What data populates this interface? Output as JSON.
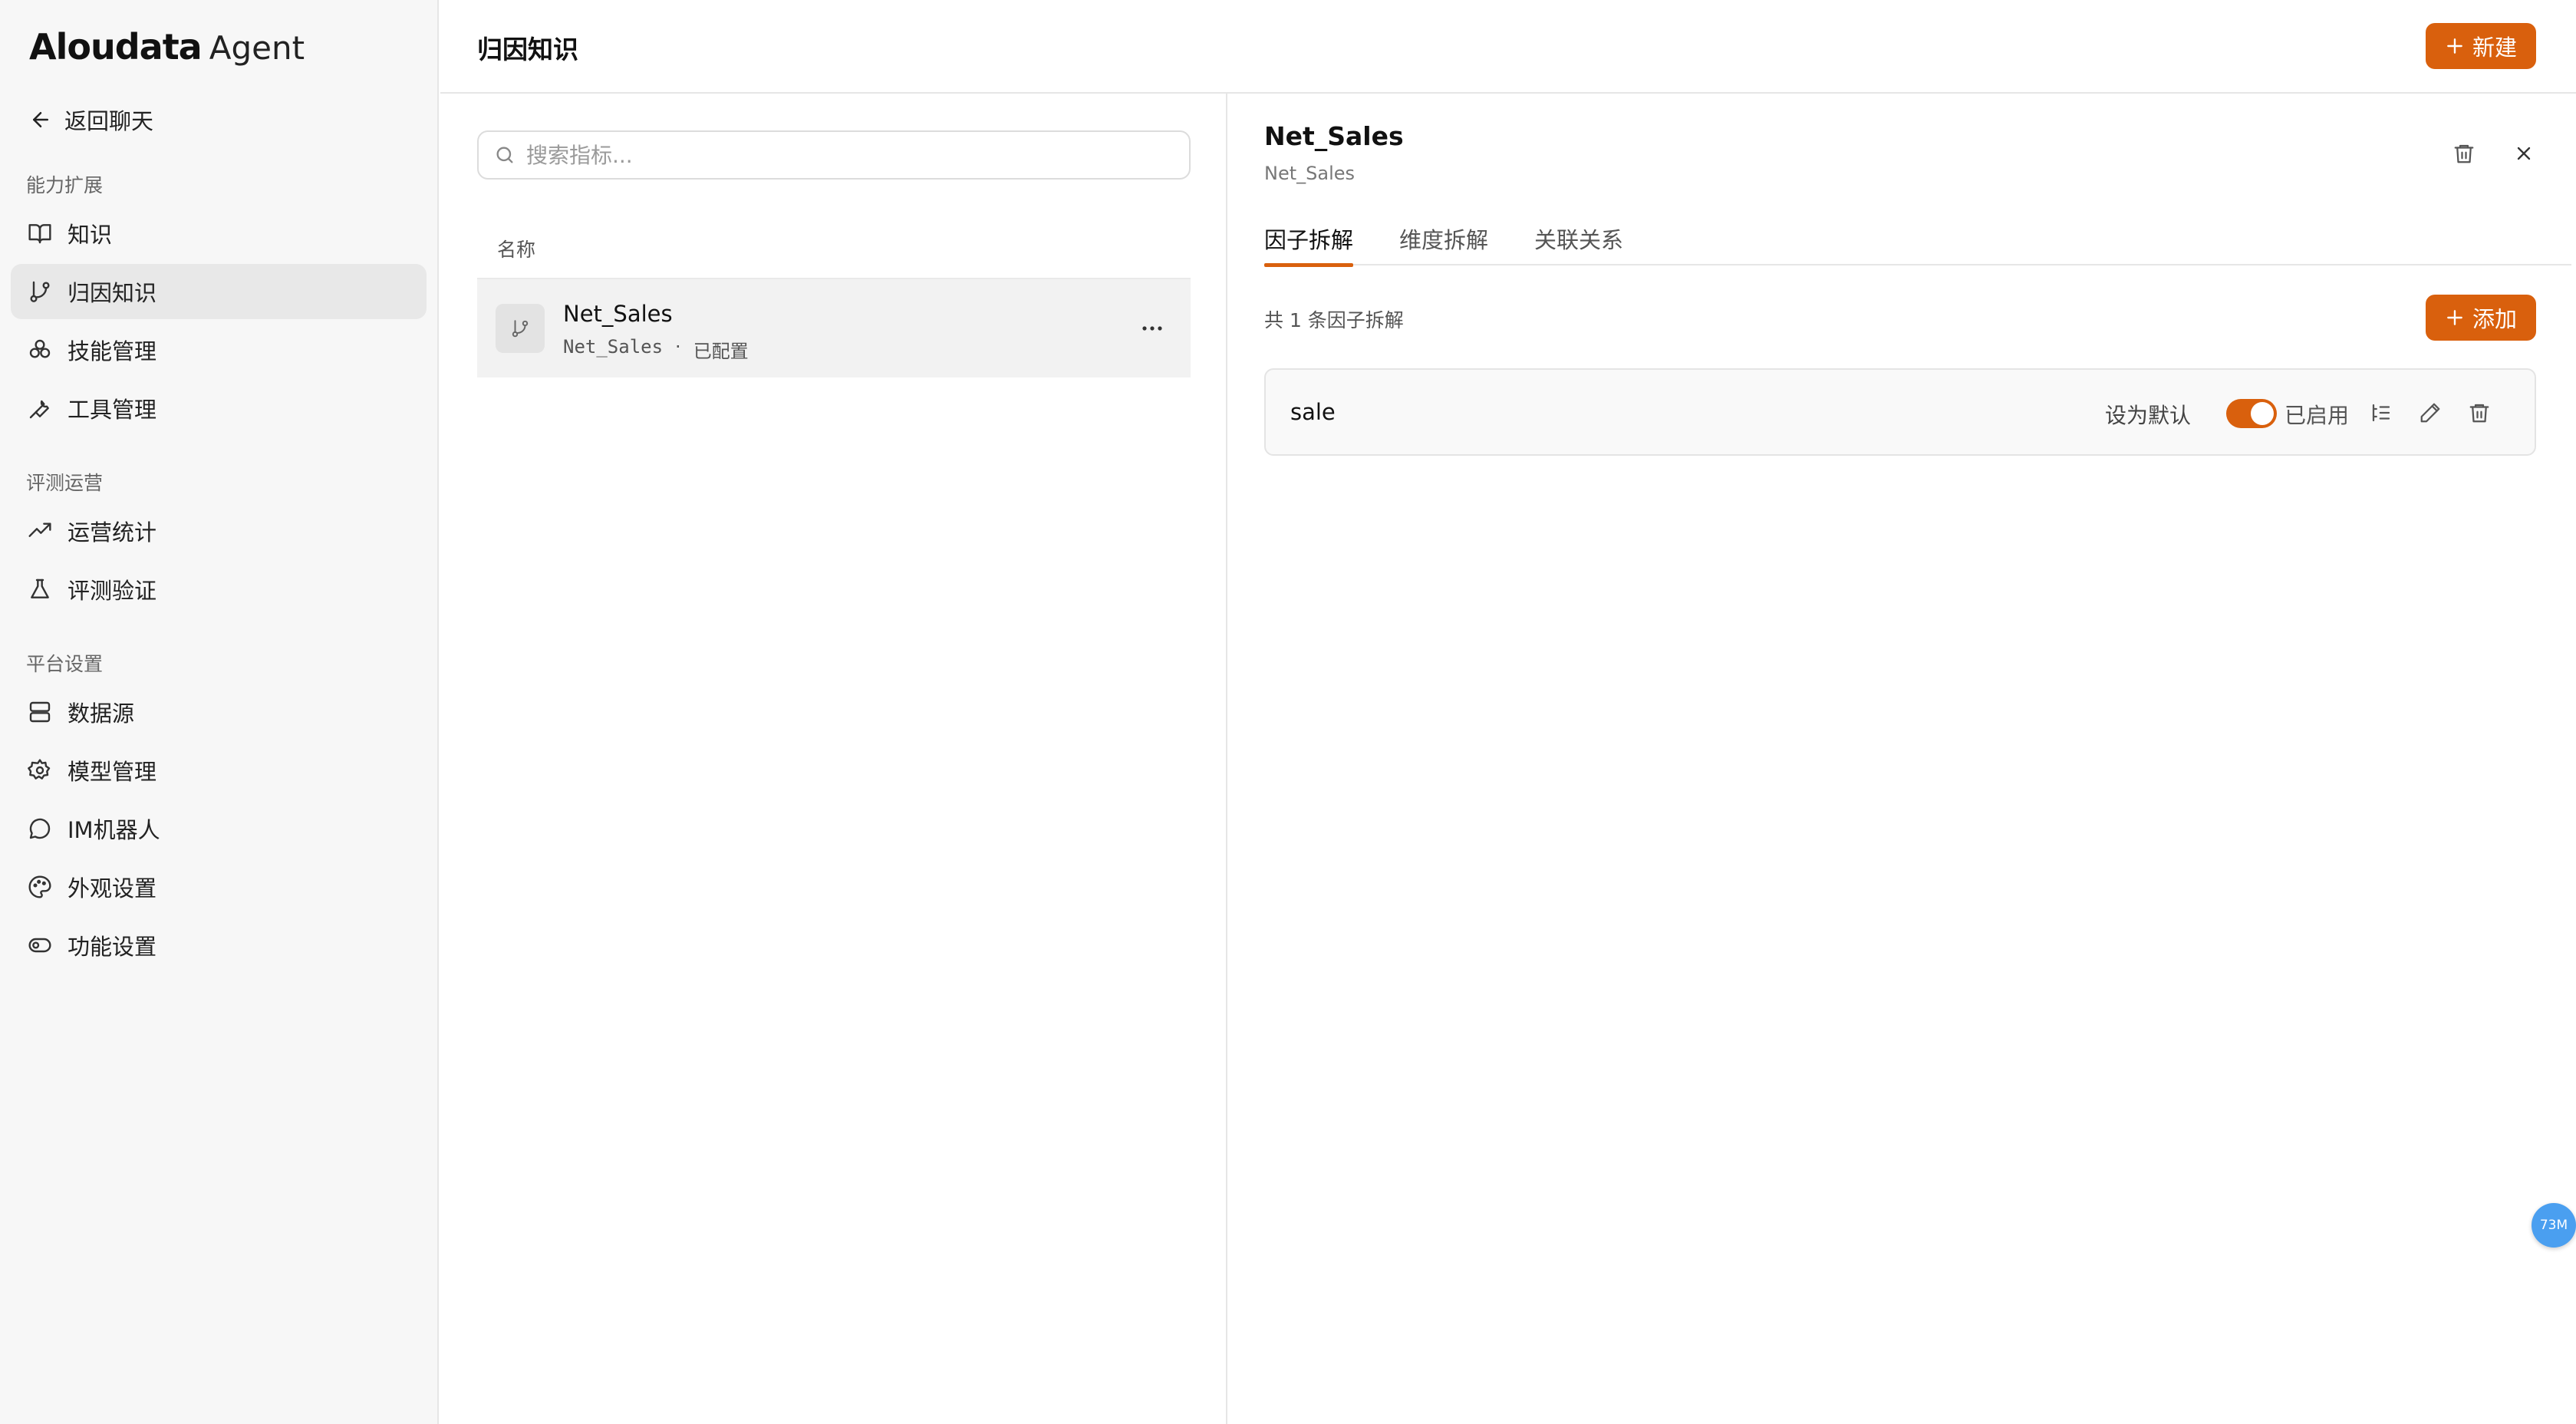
{
  "brand": {
    "main": "Aloudata",
    "sub": "Agent"
  },
  "sidebar": {
    "back_label": "返回聊天",
    "sections": [
      {
        "title": "能力扩展",
        "items": [
          {
            "label": "知识",
            "icon": "book-icon"
          },
          {
            "label": "归因知识",
            "icon": "git-branch-icon",
            "active": true
          },
          {
            "label": "技能管理",
            "icon": "atom-icon"
          },
          {
            "label": "工具管理",
            "icon": "wrench-icon"
          }
        ]
      },
      {
        "title": "评测运营",
        "items": [
          {
            "label": "运营统计",
            "icon": "trending-up-icon"
          },
          {
            "label": "评测验证",
            "icon": "flask-icon"
          }
        ]
      },
      {
        "title": "平台设置",
        "items": [
          {
            "label": "数据源",
            "icon": "server-icon"
          },
          {
            "label": "模型管理",
            "icon": "settings-icon"
          },
          {
            "label": "IM机器人",
            "icon": "message-circle-icon"
          },
          {
            "label": "外观设置",
            "icon": "palette-icon"
          },
          {
            "label": "功能设置",
            "icon": "toggle-icon"
          }
        ]
      }
    ]
  },
  "header": {
    "title": "归因知识",
    "new_button": "新建"
  },
  "list": {
    "search_placeholder": "搜索指标...",
    "column_name": "名称",
    "rows": [
      {
        "title": "Net_Sales",
        "code": "Net_Sales",
        "separator": "·",
        "status": "已配置"
      }
    ]
  },
  "detail": {
    "title": "Net_Sales",
    "subtitle": "Net_Sales",
    "tabs": [
      "因子拆解",
      "维度拆解",
      "关联关系"
    ],
    "active_tab": 0,
    "count_text": "共 1 条因子拆解",
    "add_button": "添加",
    "factors": [
      {
        "name": "sale",
        "set_default": "设为默认",
        "enabled": true,
        "enabled_label": "已启用"
      }
    ]
  },
  "badge": "73M",
  "colors": {
    "accent": "#d9600d",
    "badge": "#4a9ff0"
  }
}
